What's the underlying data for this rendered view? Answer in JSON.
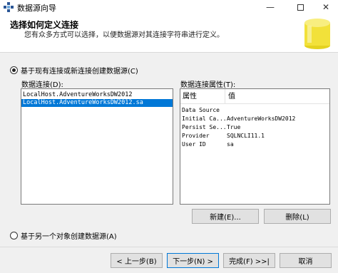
{
  "window": {
    "title": "数据源向导"
  },
  "header": {
    "title": "选择如何定义连接",
    "subtitle": "您有众多方式可以选择，以便数据源对其连接字符串进行定义。"
  },
  "options": {
    "existing_label": "基于现有连接或新连接创建数据源(C)",
    "other_label": "基于另一个对象创建数据源(A)"
  },
  "connections": {
    "label": "数据连接(D):",
    "items": [
      {
        "text": "LocalHost.AdventureWorksDW2012",
        "selected": false
      },
      {
        "text": "LocalHost.AdventureWorksDW2012.sa",
        "selected": true
      }
    ]
  },
  "properties": {
    "label": "数据连接属性(T):",
    "col_property": "属性",
    "col_value": "值",
    "rows": [
      {
        "key": "Data Source",
        "value": ""
      },
      {
        "key": "Initial Ca...",
        "value": "AdventureWorksDW2012"
      },
      {
        "key": "Persist Se...",
        "value": "True"
      },
      {
        "key": "Provider",
        "value": "SQLNCLI11.1"
      },
      {
        "key": "User ID",
        "value": "sa"
      }
    ]
  },
  "buttons": {
    "new": "新建(E)...",
    "delete": "删除(L)",
    "back": "< 上一步(B)",
    "next": "下一步(N) >",
    "finish": "完成(F) >>|",
    "cancel": "取消"
  },
  "colors": {
    "selection": "#0078d7",
    "db_icon": "#f2e13a"
  }
}
